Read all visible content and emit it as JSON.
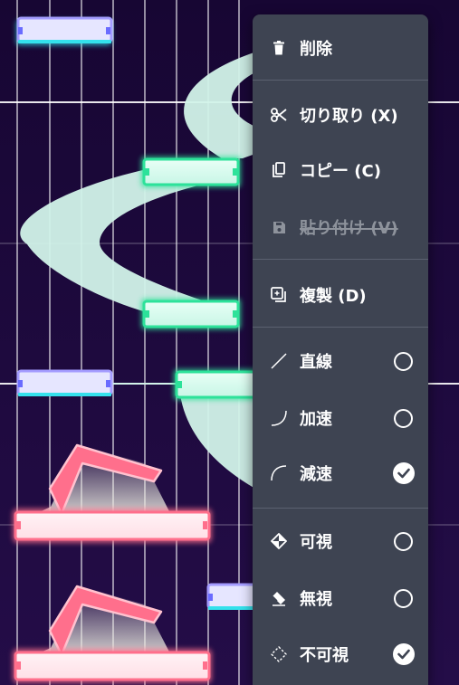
{
  "menu": {
    "items": {
      "delete": {
        "label": "削除",
        "icon": "trash-icon"
      },
      "cut": {
        "label": "切り取り (X)",
        "icon": "scissors-icon"
      },
      "copy": {
        "label": "コピー (C)",
        "icon": "copy-icon"
      },
      "paste": {
        "label": "貼り付け (V)",
        "icon": "save-icon",
        "disabled": true
      },
      "duplicate": {
        "label": "複製 (D)",
        "icon": "duplicate-icon"
      },
      "linear": {
        "label": "直線",
        "icon": "line-icon",
        "checked": false
      },
      "accelerate": {
        "label": "加速",
        "icon": "ease-in-icon",
        "checked": false
      },
      "decelerate": {
        "label": "減速",
        "icon": "ease-out-icon",
        "checked": true
      },
      "visible": {
        "label": "可視",
        "icon": "visible-diamond-icon",
        "checked": false
      },
      "ignore": {
        "label": "無視",
        "icon": "eraser-icon",
        "checked": false
      },
      "invisible": {
        "label": "不可視",
        "icon": "invisible-diamond-icon",
        "checked": true
      }
    }
  },
  "colors": {
    "background": "#1a0838",
    "menu_bg": "#3e4452",
    "slide_path": "#d2f3e9",
    "note_green": "#2de29a",
    "note_purple": "#a49cff",
    "note_cyan": "#34e1ec",
    "flick_pink": "#ff6f8c"
  }
}
